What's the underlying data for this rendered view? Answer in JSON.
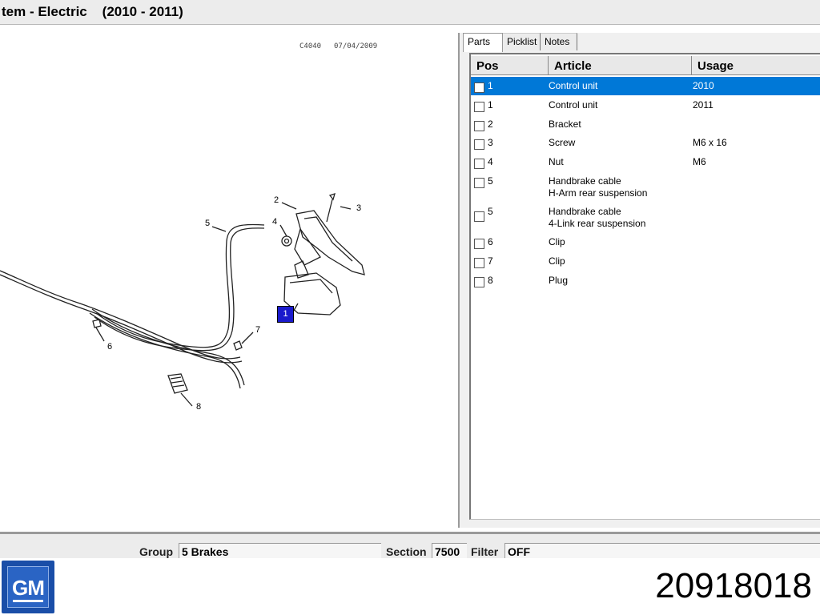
{
  "window": {
    "title": "tem - Electric    (2010 - 2011)"
  },
  "diagram": {
    "header_left": "C4040",
    "header_right": "07/04/2009",
    "selected_marker": "1",
    "labels": [
      "2",
      "3",
      "4",
      "5",
      "6",
      "7",
      "8"
    ]
  },
  "tabs": [
    {
      "label": "Parts",
      "active": true
    },
    {
      "label": "Picklist",
      "active": false
    },
    {
      "label": "Notes",
      "active": false
    }
  ],
  "table": {
    "headers": {
      "pos": "Pos",
      "article": "Article",
      "usage": "Usage"
    },
    "rows": [
      {
        "pos": "1",
        "article": "Control unit",
        "usage": "2010",
        "selected": true
      },
      {
        "pos": "1",
        "article": "Control unit",
        "usage": "2011",
        "selected": false
      },
      {
        "pos": "2",
        "article": "Bracket",
        "usage": "",
        "selected": false
      },
      {
        "pos": "3",
        "article": "Screw",
        "usage": "M6 x 16",
        "selected": false
      },
      {
        "pos": "4",
        "article": "Nut",
        "usage": "M6",
        "selected": false
      },
      {
        "pos": "5",
        "article": "Handbrake cable",
        "article2": "H-Arm rear suspension",
        "usage": "",
        "selected": false
      },
      {
        "pos": "5",
        "article": "Handbrake cable",
        "article2": "4-Link rear suspension",
        "usage": "",
        "selected": false
      },
      {
        "pos": "6",
        "article": "Clip",
        "usage": "",
        "selected": false
      },
      {
        "pos": "7",
        "article": "Clip",
        "usage": "",
        "selected": false
      },
      {
        "pos": "8",
        "article": "Plug",
        "usage": "",
        "selected": false
      }
    ]
  },
  "status": {
    "group_label": "Group",
    "group_value": "5 Brakes",
    "section_label": "Section",
    "section_value": "7500",
    "filter_label": "Filter",
    "filter_value": "OFF"
  },
  "footer": {
    "logo_text": "GM",
    "part_number": "20918018"
  },
  "colors": {
    "selection": "#0078d7",
    "marker": "#1a1acc",
    "logo": "#1a4ea8"
  }
}
